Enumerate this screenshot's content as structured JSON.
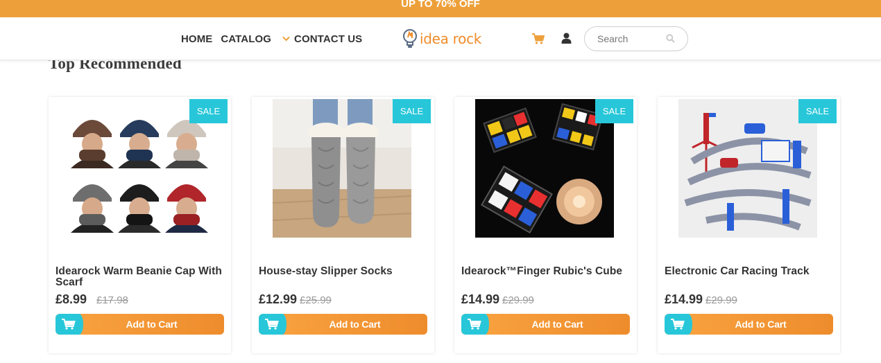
{
  "promo": {
    "text": "UP TO 70% OFF"
  },
  "nav": {
    "home": "HOME",
    "catalog": "CATALOG",
    "contact": "CONTACT US"
  },
  "logo": {
    "text": "idea rock"
  },
  "search": {
    "placeholder": "Search",
    "value": ""
  },
  "section": {
    "title": "Top Recommended"
  },
  "colors": {
    "accent": "#eda03a",
    "sale": "#27c7d9",
    "button_start": "#f9a441",
    "button_end": "#ee8c2c"
  },
  "products": [
    {
      "badge": "SALE",
      "title": "Idearock Warm Beanie Cap With Scarf",
      "price": "£8.99",
      "old_price": "£17.98",
      "button": "Add to Cart",
      "image": "beanie-scarf-grid"
    },
    {
      "badge": "SALE",
      "title": "House-stay Slipper Socks",
      "price": "£12.99",
      "old_price": "£25.99",
      "button": "Add to Cart",
      "image": "grey-knit-socks"
    },
    {
      "badge": "SALE",
      "title": "Idearock™Finger Rubic's Cube",
      "price": "£14.99",
      "old_price": "£29.99",
      "button": "Add to Cart",
      "image": "spinner-cubes"
    },
    {
      "badge": "SALE",
      "title": "Electronic Car Racing Track",
      "price": "£14.99",
      "old_price": "£29.99",
      "button": "Add to Cart",
      "image": "race-track"
    }
  ]
}
